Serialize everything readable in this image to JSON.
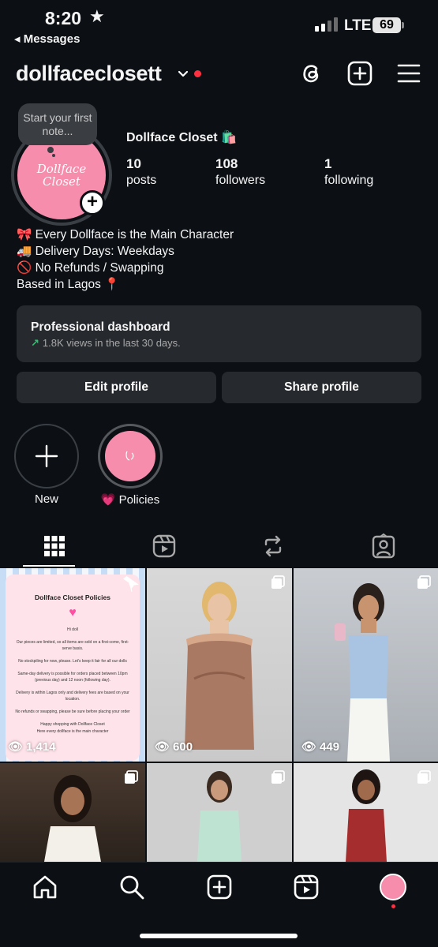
{
  "status_bar": {
    "time": "8:20",
    "back_label": "◂ Messages",
    "network": "LTE",
    "battery": "69"
  },
  "header": {
    "username": "dollfaceclosett",
    "icons": [
      "threads-icon",
      "create-icon",
      "menu-icon"
    ]
  },
  "profile": {
    "note_placeholder": "Start your first note...",
    "avatar_logo_text": "Dollface Closet",
    "display_name": "Dollface Closet 🛍️",
    "stats": [
      {
        "num": "10",
        "label": "posts"
      },
      {
        "num": "108",
        "label": "followers"
      },
      {
        "num": "1",
        "label": "following"
      }
    ],
    "bio": [
      "🎀 Every Dollface is the Main Character",
      "🚚 Delivery Days: Weekdays",
      "🚫 No Refunds / Swapping",
      "Based in Lagos 📍"
    ]
  },
  "dashboard": {
    "title": "Professional dashboard",
    "arrow": "↗",
    "subtitle": "1.8K views in the last 30 days."
  },
  "buttons": {
    "edit": "Edit profile",
    "share": "Share profile"
  },
  "highlights": [
    {
      "label": "New"
    },
    {
      "label": "💗 Policies"
    }
  ],
  "grid": {
    "policy_card": {
      "title": "Dollface Closet Policies",
      "greeting": "Hi doll",
      "lines": [
        "Our pieces are limited, so all items are sold on a first-come, first-serve basis.",
        "No stockpiling for now, please. Let's keep it fair for all our dolls",
        "Same-day delivery is possible for orders placed between 10pm (previous day) and 12 noon (following day).",
        "Delivery is within Lagos only and delivery fees are based on your location.",
        "No refunds or swapping, please be sure before placing your order",
        "Happy shopping with Dollface Closet",
        "Here every dollface is the main character"
      ]
    },
    "posts": [
      {
        "views": "1,414"
      },
      {
        "views": "600"
      },
      {
        "views": "449"
      },
      {
        "views": ""
      },
      {
        "views": ""
      },
      {
        "views": ""
      }
    ]
  },
  "colors": {
    "background": "#0c1014",
    "card": "#262a2f",
    "brand_pink": "#f78dac",
    "notification_red": "#ff3040",
    "trend_green": "#28c76f"
  }
}
